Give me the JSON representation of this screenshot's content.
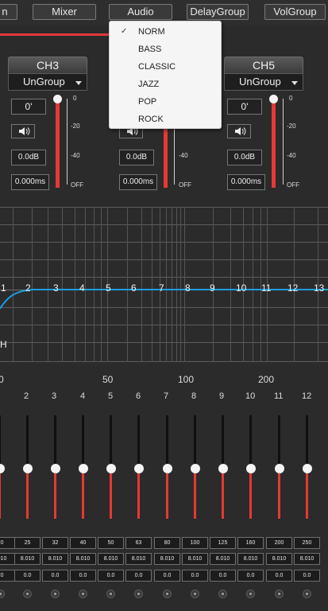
{
  "tabs": [
    {
      "label": "n"
    },
    {
      "label": "Mixer"
    },
    {
      "label": "Audio"
    },
    {
      "label": "DelayGroup"
    },
    {
      "label": "VolGroup"
    }
  ],
  "eq_preset_menu": {
    "selected": "NORM",
    "items": [
      "NORM",
      "BASS",
      "CLASSIC",
      "JAZZ",
      "POP",
      "ROCK"
    ]
  },
  "channels": [
    {
      "name": "CH3",
      "group": "UnGroup",
      "phase": "0'",
      "gain": "0.0dB",
      "delay": "0.000ms"
    },
    {
      "name": "",
      "group": "",
      "phase": "",
      "gain": "0.0dB",
      "delay": "0.000ms"
    },
    {
      "name": "CH5",
      "group": "UnGroup",
      "phase": "0'",
      "gain": "0.0dB",
      "delay": "0.000ms"
    }
  ],
  "level_scale": [
    "0",
    "-20",
    "-40",
    "OFF"
  ],
  "eq_graph": {
    "band_labels": [
      "1",
      "2",
      "3",
      "4",
      "5",
      "6",
      "7",
      "8",
      "9",
      "10",
      "11",
      "12",
      "13"
    ],
    "x_axis_labels": [
      "0",
      "50",
      "100",
      "200"
    ],
    "side_label": "H"
  },
  "eq_bands": {
    "numbers": [
      "2",
      "3",
      "4",
      "5",
      "6",
      "7",
      "8",
      "9",
      "10",
      "11",
      "12"
    ],
    "freq": [
      "0",
      "25",
      "32",
      "40",
      "50",
      "63",
      "80",
      "100",
      "125",
      "160",
      "200",
      "250"
    ],
    "q": [
      "010",
      "8.010",
      "8.010",
      "8.010",
      "8.010",
      "8.010",
      "8.010",
      "8.010",
      "8.010",
      "8.010",
      "8.010",
      "8.010"
    ],
    "gain": [
      "0",
      "0.0",
      "0.0",
      "0.0",
      "0.0",
      "0.0",
      "0.0",
      "0.0",
      "0.0",
      "0.0",
      "0.0",
      "0.0"
    ]
  },
  "colors": {
    "accent_red": "#e53935",
    "curve_blue": "#1e9be0",
    "background": "#2b2b2b"
  }
}
